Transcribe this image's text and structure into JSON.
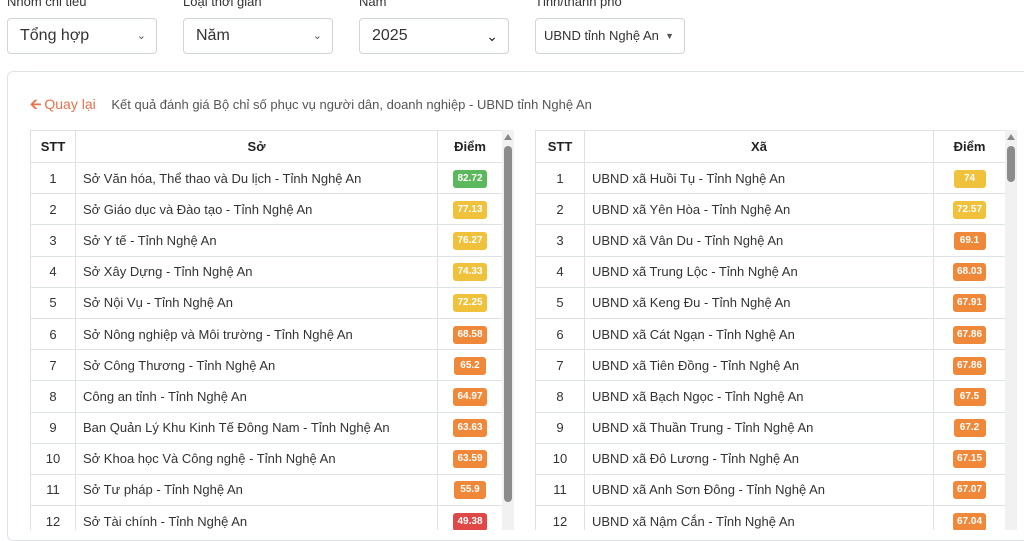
{
  "filters": {
    "group": {
      "label": "Nhóm chỉ tiêu",
      "value": "Tổng hợp"
    },
    "time_type": {
      "label": "Loại thời gian",
      "value": "Năm"
    },
    "year": {
      "label": "Năm",
      "value": "2025"
    },
    "province": {
      "label": "Tỉnh/thành phố",
      "value": "UBND tỉnh Nghệ An"
    }
  },
  "back_label": "Quay lại",
  "breadcrumb": "Kết quả đánh giá Bộ chỉ số phục vụ người dân, doanh nghiệp - UBND tỉnh Nghệ An",
  "colors": {
    "green": "#5cb85c",
    "yellow": "#f0c23b",
    "orange": "#f0883a",
    "red": "#e04848"
  },
  "left_table": {
    "headers": [
      "STT",
      "Sở",
      "Điểm"
    ],
    "rows": [
      {
        "stt": "1",
        "name": "Sở Văn hóa, Thể thao và Du lịch - Tỉnh Nghệ An",
        "score": "82.72",
        "color": "green"
      },
      {
        "stt": "2",
        "name": "Sở Giáo dục và Đào tạo - Tỉnh Nghệ An",
        "score": "77.13",
        "color": "yellow"
      },
      {
        "stt": "3",
        "name": "Sở Y tế - Tỉnh Nghệ An",
        "score": "76.27",
        "color": "yellow"
      },
      {
        "stt": "4",
        "name": "Sở Xây Dựng - Tỉnh Nghệ An",
        "score": "74.33",
        "color": "yellow"
      },
      {
        "stt": "5",
        "name": "Sở Nội Vụ - Tỉnh Nghệ An",
        "score": "72.25",
        "color": "yellow"
      },
      {
        "stt": "6",
        "name": "Sở Nông nghiệp và Môi trường - Tỉnh Nghệ An",
        "score": "68.58",
        "color": "orange"
      },
      {
        "stt": "7",
        "name": "Sở Công Thương - Tỉnh Nghệ An",
        "score": "65.2",
        "color": "orange"
      },
      {
        "stt": "8",
        "name": "Công an tỉnh - Tỉnh Nghệ An",
        "score": "64.97",
        "color": "orange"
      },
      {
        "stt": "9",
        "name": "Ban Quản Lý Khu Kinh Tế Đông Nam - Tỉnh Nghệ An",
        "score": "63.63",
        "color": "orange"
      },
      {
        "stt": "10",
        "name": "Sở Khoa học Và Công nghệ - Tỉnh Nghệ An",
        "score": "63.59",
        "color": "orange"
      },
      {
        "stt": "11",
        "name": "Sở Tư pháp - Tỉnh Nghệ An",
        "score": "55.9",
        "color": "orange"
      },
      {
        "stt": "12",
        "name": "Sở Tài chính - Tỉnh Nghệ An",
        "score": "49.38",
        "color": "red"
      }
    ]
  },
  "right_table": {
    "headers": [
      "STT",
      "Xã",
      "Điểm"
    ],
    "rows": [
      {
        "stt": "1",
        "name": "UBND xã Huồi Tụ - Tỉnh Nghệ An",
        "score": "74",
        "color": "yellow"
      },
      {
        "stt": "2",
        "name": "UBND xã Yên Hòa - Tỉnh Nghệ An",
        "score": "72.57",
        "color": "yellow"
      },
      {
        "stt": "3",
        "name": "UBND xã Vân Du - Tỉnh Nghệ An",
        "score": "69.1",
        "color": "orange"
      },
      {
        "stt": "4",
        "name": "UBND xã Trung Lộc - Tỉnh Nghệ An",
        "score": "68.03",
        "color": "orange"
      },
      {
        "stt": "5",
        "name": "UBND xã Keng Đu - Tỉnh Nghệ An",
        "score": "67.91",
        "color": "orange"
      },
      {
        "stt": "6",
        "name": "UBND xã Cát Ngạn - Tỉnh Nghệ An",
        "score": "67.86",
        "color": "orange"
      },
      {
        "stt": "7",
        "name": "UBND xã Tiên Đồng - Tỉnh Nghệ An",
        "score": "67.86",
        "color": "orange"
      },
      {
        "stt": "8",
        "name": "UBND xã Bạch Ngọc - Tỉnh Nghệ An",
        "score": "67.5",
        "color": "orange"
      },
      {
        "stt": "9",
        "name": "UBND xã Thuần Trung - Tỉnh Nghệ An",
        "score": "67.2",
        "color": "orange"
      },
      {
        "stt": "10",
        "name": "UBND xã Đô Lương - Tỉnh Nghệ An",
        "score": "67.15",
        "color": "orange"
      },
      {
        "stt": "11",
        "name": "UBND xã Anh Sơn Đông - Tỉnh Nghệ An",
        "score": "67.07",
        "color": "orange"
      },
      {
        "stt": "12",
        "name": "UBND xã Nậm Cắn - Tỉnh Nghệ An",
        "score": "67.04",
        "color": "orange"
      }
    ]
  }
}
